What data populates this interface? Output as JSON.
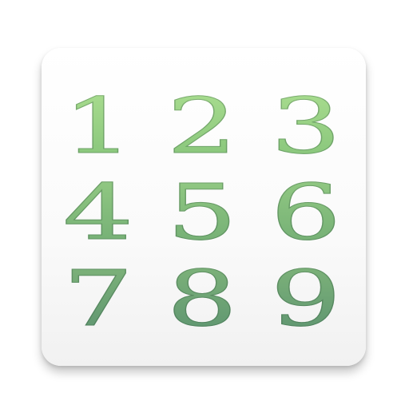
{
  "icon": {
    "digits": [
      "1",
      "2",
      "3",
      "4",
      "5",
      "6",
      "7",
      "8",
      "9"
    ],
    "colors": {
      "tile_background": "#ffffff",
      "digit_top": "#a9dd8f",
      "digit_bottom": "#5d9470"
    }
  }
}
